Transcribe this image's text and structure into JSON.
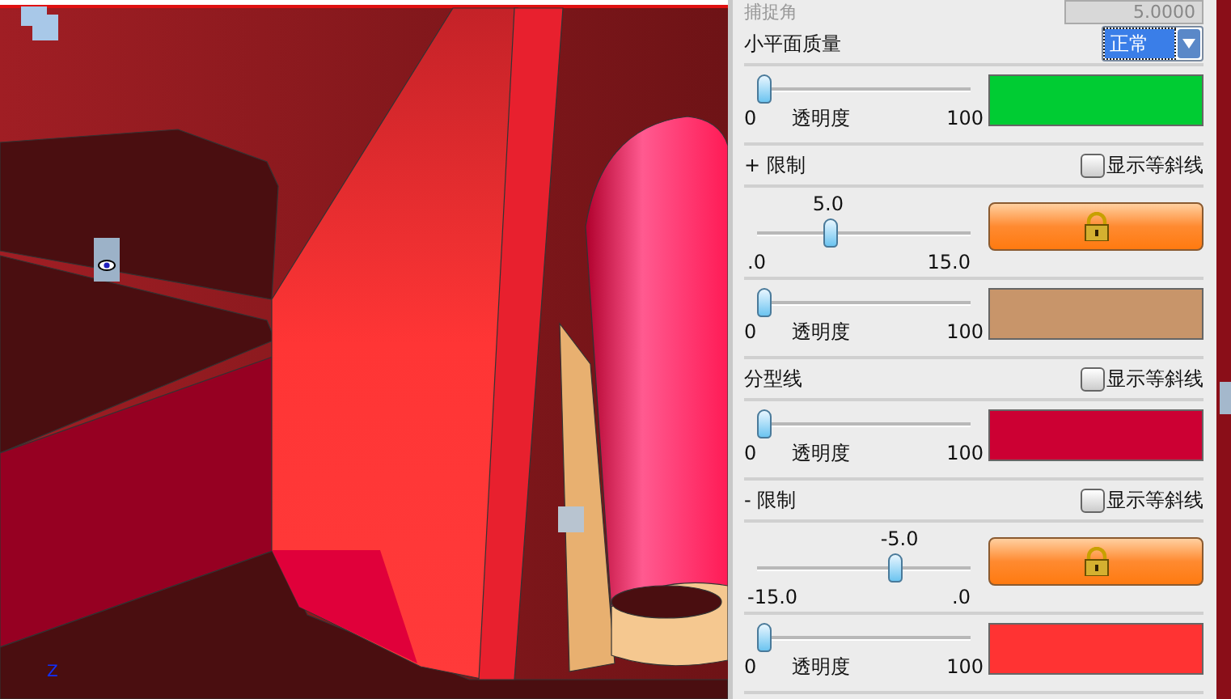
{
  "viewport": {
    "axis_label": "Z"
  },
  "panel": {
    "snap": {
      "label": "捕捉角",
      "value": "5.0000",
      "disabled": true
    },
    "quality": {
      "label": "小平面质量",
      "value": "正常"
    },
    "rows": [
      {
        "kind": "color",
        "level": 0,
        "min": "0",
        "caption": "透明度",
        "max": "100",
        "color": "#00cc33"
      },
      {
        "kind": "header",
        "label": "+ 限制",
        "checkbox": {
          "label": "显示等斜线",
          "checked": false
        }
      },
      {
        "kind": "limit",
        "value": "5.0",
        "level": 0.333,
        "min": ".0",
        "max": "15.0"
      },
      {
        "kind": "color",
        "level": 0,
        "min": "0",
        "caption": "透明度",
        "max": "100",
        "color": "#c8956a"
      },
      {
        "kind": "header",
        "label": "分型线",
        "checkbox": {
          "label": "显示等斜线",
          "checked": false
        }
      },
      {
        "kind": "color",
        "level": 0,
        "min": "0",
        "caption": "透明度",
        "max": "100",
        "color": "#cc0033"
      },
      {
        "kind": "header",
        "label": "- 限制",
        "checkbox": {
          "label": "显示等斜线",
          "checked": false
        }
      },
      {
        "kind": "limit",
        "value": "-5.0",
        "level": 0.667,
        "min": "-15.0",
        "max": ".0"
      },
      {
        "kind": "color",
        "level": 0,
        "min": "0",
        "caption": "透明度",
        "max": "100",
        "color": "#ff3333"
      }
    ]
  }
}
